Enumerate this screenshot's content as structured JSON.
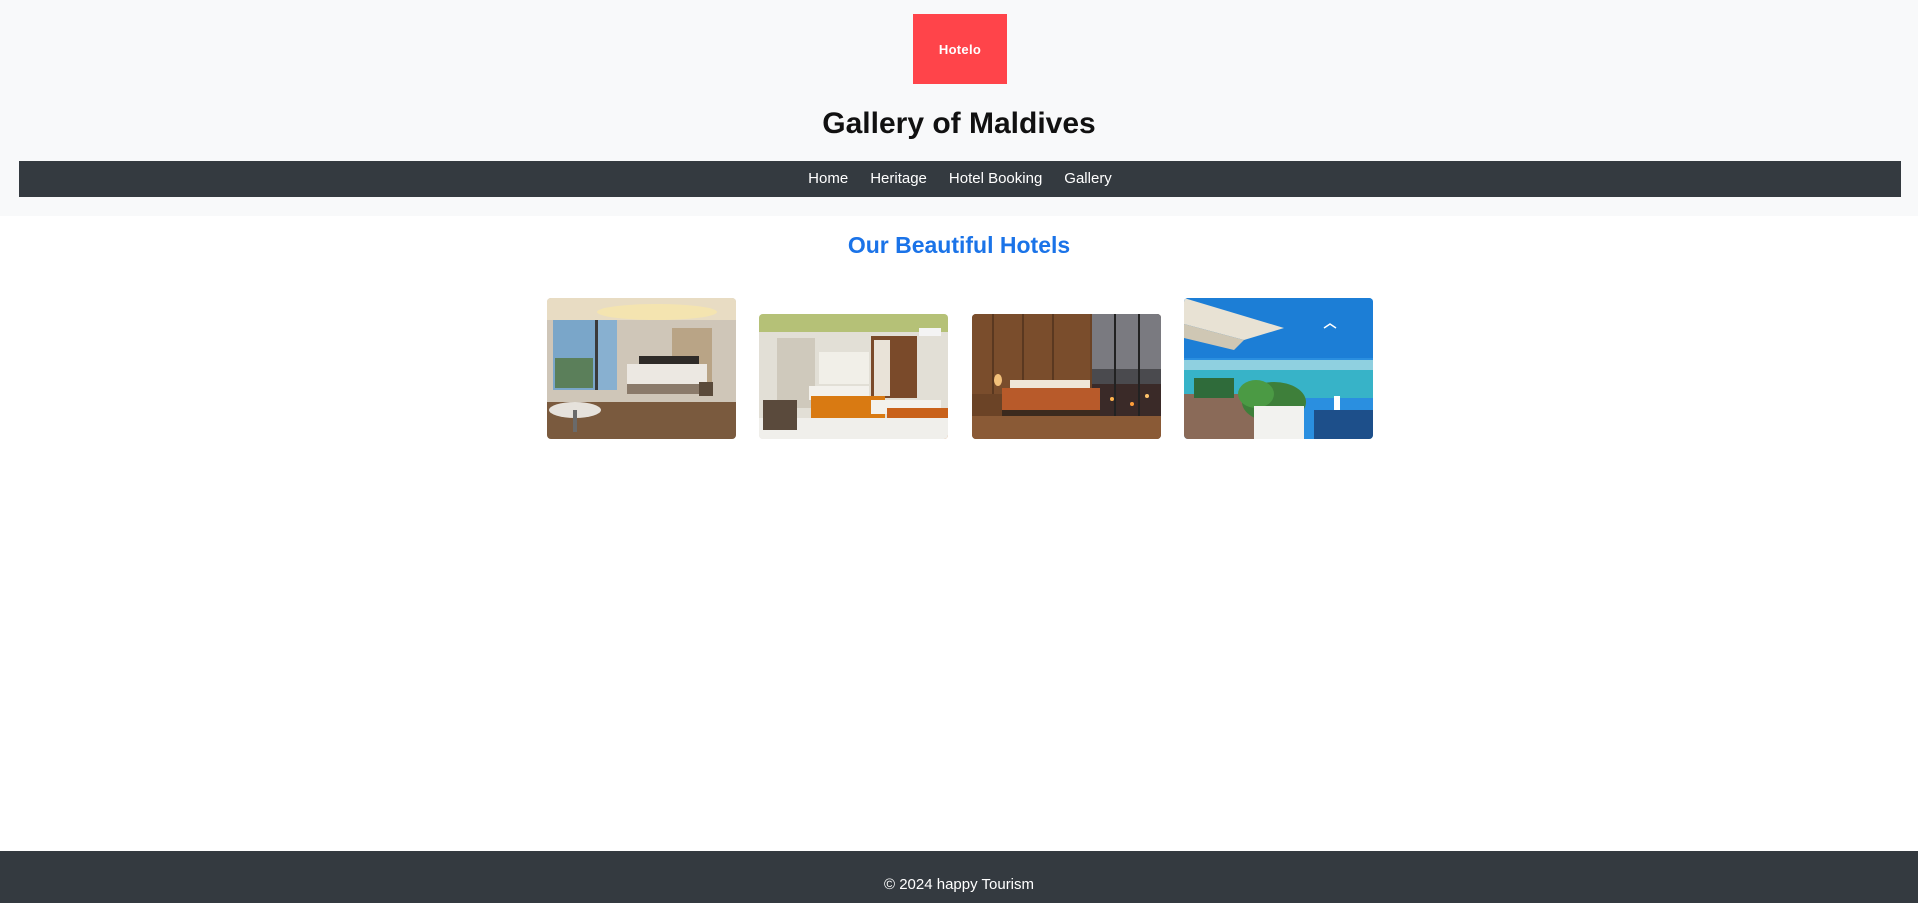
{
  "header": {
    "logo_text": "Hotelo",
    "title": "Gallery of Maldives"
  },
  "nav": {
    "items": [
      {
        "label": "Home"
      },
      {
        "label": "Heritage"
      },
      {
        "label": "Hotel Booking"
      },
      {
        "label": "Gallery"
      }
    ]
  },
  "main": {
    "section_title": "Our Beautiful Hotels"
  },
  "footer": {
    "copyright": "© 2024 happy Tourism"
  },
  "colors": {
    "logo_bg": "#ff444a",
    "nav_bg": "#343a40",
    "footer_bg": "#343a40",
    "header_bg": "#f8f9fa",
    "accent": "#1a73e8"
  }
}
